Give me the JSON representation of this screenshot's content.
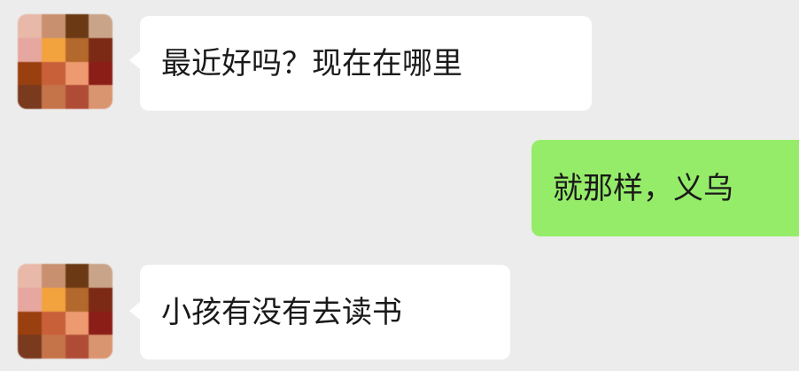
{
  "colors": {
    "background": "#ececec",
    "incoming_bubble": "#ffffff",
    "outgoing_bubble": "#95ec69",
    "text": "#1a1a1a"
  },
  "messages": [
    {
      "sender": "contact",
      "text": "最近好吗？现在在哪里",
      "avatar_icon": "pixelated-avatar-icon"
    },
    {
      "sender": "self",
      "text": "就那样，义乌"
    },
    {
      "sender": "contact",
      "text": "小孩有没有去读书",
      "avatar_icon": "pixelated-avatar-icon"
    }
  ]
}
